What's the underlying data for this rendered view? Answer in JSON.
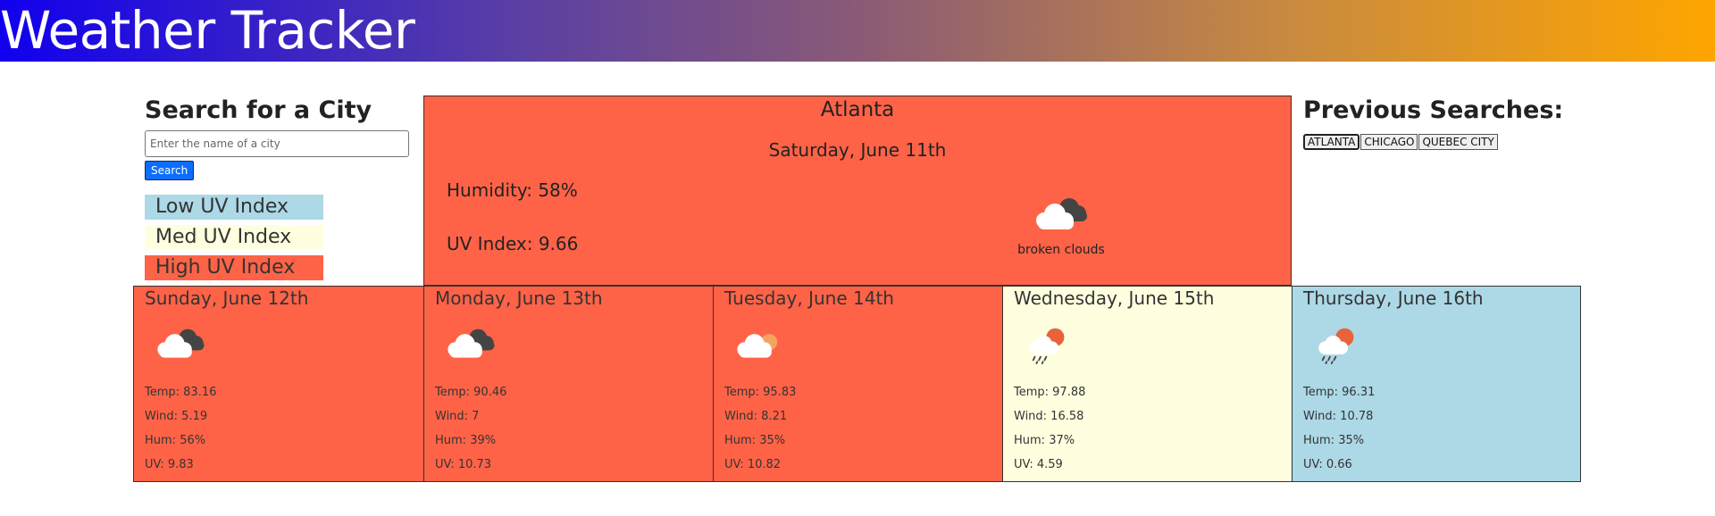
{
  "header": {
    "title": "Weather Tracker"
  },
  "search": {
    "title": "Search for a City",
    "placeholder": "Enter the name of a city",
    "button_label": "Search"
  },
  "legend": {
    "low": "Low UV Index",
    "med": "Med UV Index",
    "high": "High UV Index"
  },
  "current": {
    "city": "Atlanta",
    "date": "Saturday, June 11th",
    "humidity": "Humidity: 58%",
    "uv": "UV Index: 9.66",
    "description": "broken clouds",
    "icon": "broken-clouds-icon"
  },
  "forecast": [
    {
      "date": "Sunday, June 12th",
      "icon": "broken-clouds-icon",
      "temp": "Temp: 83.16",
      "wind": "Wind: 5.19",
      "hum": "Hum: 56%",
      "uv": "UV: 9.83",
      "color": "#ff6347"
    },
    {
      "date": "Monday, June 13th",
      "icon": "broken-clouds-icon",
      "temp": "Temp: 90.46",
      "wind": "Wind: 7",
      "hum": "Hum: 39%",
      "uv": "UV: 10.73",
      "color": "#ff6347"
    },
    {
      "date": "Tuesday, June 14th",
      "icon": "few-clouds-icon",
      "temp": "Temp: 95.83",
      "wind": "Wind: 8.21",
      "hum": "Hum: 35%",
      "uv": "UV: 10.82",
      "color": "#ff6347"
    },
    {
      "date": "Wednesday, June 15th",
      "icon": "sun-rain-icon",
      "temp": "Temp: 97.88",
      "wind": "Wind: 16.58",
      "hum": "Hum: 37%",
      "uv": "UV: 4.59",
      "color": "#ffffe0"
    },
    {
      "date": "Thursday, June 16th",
      "icon": "sun-rain-icon",
      "temp": "Temp: 96.31",
      "wind": "Wind: 10.78",
      "hum": "Hum: 35%",
      "uv": "UV: 0.66",
      "color": "#add8e6"
    }
  ],
  "history": {
    "title": "Previous Searches:",
    "items": [
      "ATLANTA",
      "CHICAGO",
      "QUEBEC CITY"
    ]
  },
  "colors": {
    "high_uv": "#ff6347",
    "med_uv": "#ffffe0",
    "low_uv": "#add8e6",
    "button": "#0d6efd"
  }
}
